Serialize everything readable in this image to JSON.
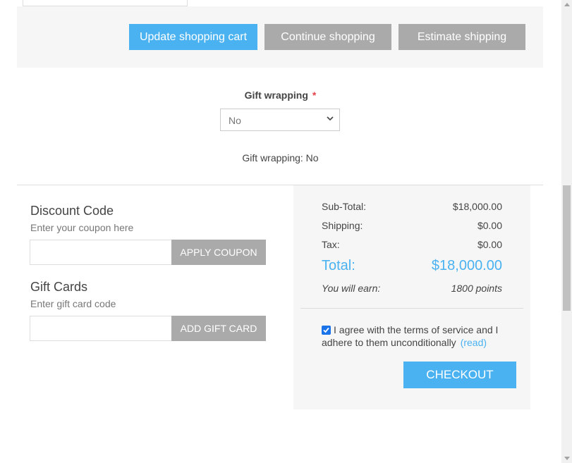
{
  "cart_actions": {
    "update_label": "Update shopping cart",
    "continue_label": "Continue shopping",
    "estimate_label": "Estimate shipping"
  },
  "gift_wrapping": {
    "label": "Gift wrapping",
    "required_mark": "*",
    "selected": "No",
    "summary": "Gift wrapping: No"
  },
  "discount": {
    "title": "Discount Code",
    "hint": "Enter your coupon here",
    "button_label": "APPLY COUPON"
  },
  "gift_cards": {
    "title": "Gift Cards",
    "hint": "Enter gift card code",
    "button_label": "ADD GIFT CARD"
  },
  "totals": {
    "subtotal_label": "Sub-Total:",
    "subtotal_value": "$18,000.00",
    "shipping_label": "Shipping:",
    "shipping_value": "$0.00",
    "tax_label": "Tax:",
    "tax_value": "$0.00",
    "total_label": "Total:",
    "total_value": "$18,000.00",
    "earn_label": "You will earn:",
    "earn_value": "1800 points"
  },
  "terms": {
    "text": "I agree with the terms of service and I adhere to them unconditionally",
    "link_label": "(read)",
    "checked": true
  },
  "checkout_label": "CHECKOUT",
  "colors": {
    "accent": "#4ab2f1",
    "secondary_button": "#aaaaaa",
    "required": "#e4434b",
    "panel_bg": "#f6f6f6"
  }
}
